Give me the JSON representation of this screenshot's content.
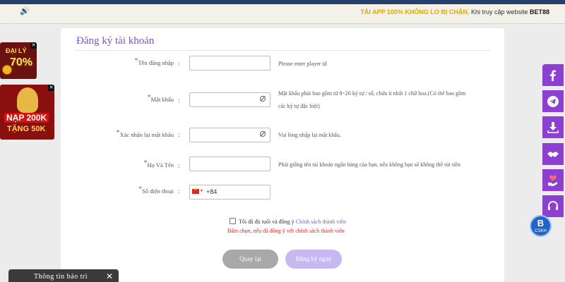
{
  "banner": {
    "marquee_highlight": "TẢI APP 100% KHÔNG LO BỊ CHẶN,",
    "marquee_text": " Khi truy cập website ",
    "marquee_brand": "BET88"
  },
  "form": {
    "title": "Đăng ký tài khoản",
    "fields": [
      {
        "label": "Tên đăng nhập",
        "hint": "Please enter player id"
      },
      {
        "label": "Mật khẩu",
        "hint": "Mật khẩu phải bao gồm từ 8~20 ký tự / số, chứa ít nhất 1 chữ hoa.(Có thể bao gồm các ký tự đặc biệt)"
      },
      {
        "label": "Xác nhận lại mật khẩu",
        "hint": "Vui lòng nhập lại mật khẩu."
      },
      {
        "label": "Họ Và Tên",
        "hint": "Phải giống tên tài khoản ngân hàng của bạn, nếu không bạn sẽ không thể rút tiền"
      },
      {
        "label": "Số điện thoại",
        "prefix": "+84"
      }
    ],
    "agree_text": "Tôi đã đủ tuổi và đồng ý",
    "agree_link": "Chính sách thành viên",
    "warning": "Bấm chọn, nếu đã đồng ý với chính sách thành viên",
    "back_label": "Quay lại",
    "register_label": "Đăng ký ngay"
  },
  "promos": {
    "promo1_title": "ĐẠI LÝ",
    "promo1_value": "70%",
    "promo2_title": "NẠP 200K",
    "promo2_value": "TẶNG 50K"
  },
  "social": [
    "facebook-icon",
    "telegram-icon",
    "download-icon",
    "handshake-icon",
    "heart-hand-icon",
    "support-icon"
  ],
  "support": {
    "logo": "B",
    "label": "CSKH"
  },
  "tray": {
    "label": "Thông tin bảo trì",
    "close": "✕"
  },
  "colors": {
    "accent": "#8d3fd1",
    "title": "#7a4fc8",
    "warning": "#e02020",
    "back": "#a8a8a8",
    "register": "#c7b8f2"
  }
}
